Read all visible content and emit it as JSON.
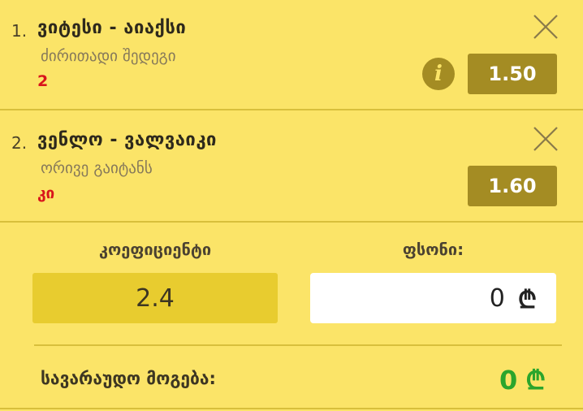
{
  "bets": [
    {
      "number": "1.",
      "match": "ვიტესი - აიაქსი",
      "market": "ძირითადი შედეგი",
      "selection": "2",
      "odds": "1.50",
      "has_info": true
    },
    {
      "number": "2.",
      "match": "ვენლო - ვალვაიკი",
      "market": "ორივე გაიტანს",
      "selection": "კი",
      "odds": "1.60",
      "has_info": false
    }
  ],
  "summary": {
    "coefficient_label": "კოეფიციენტი",
    "coefficient_value": "2.4",
    "stake_label": "ფსონი:",
    "stake_value": "0",
    "currency_symbol": "₾",
    "potential_win_label": "სავარაუდო მოგება:",
    "potential_win_value": "0"
  },
  "icons": {
    "close": "close-icon",
    "info": "info-icon",
    "info_glyph": "i"
  },
  "colors": {
    "background": "#fbe468",
    "odds_box": "#a48c23",
    "selection_text": "#d8151c",
    "win_text": "#2ba52c",
    "coef_box": "#e8cc2f"
  }
}
